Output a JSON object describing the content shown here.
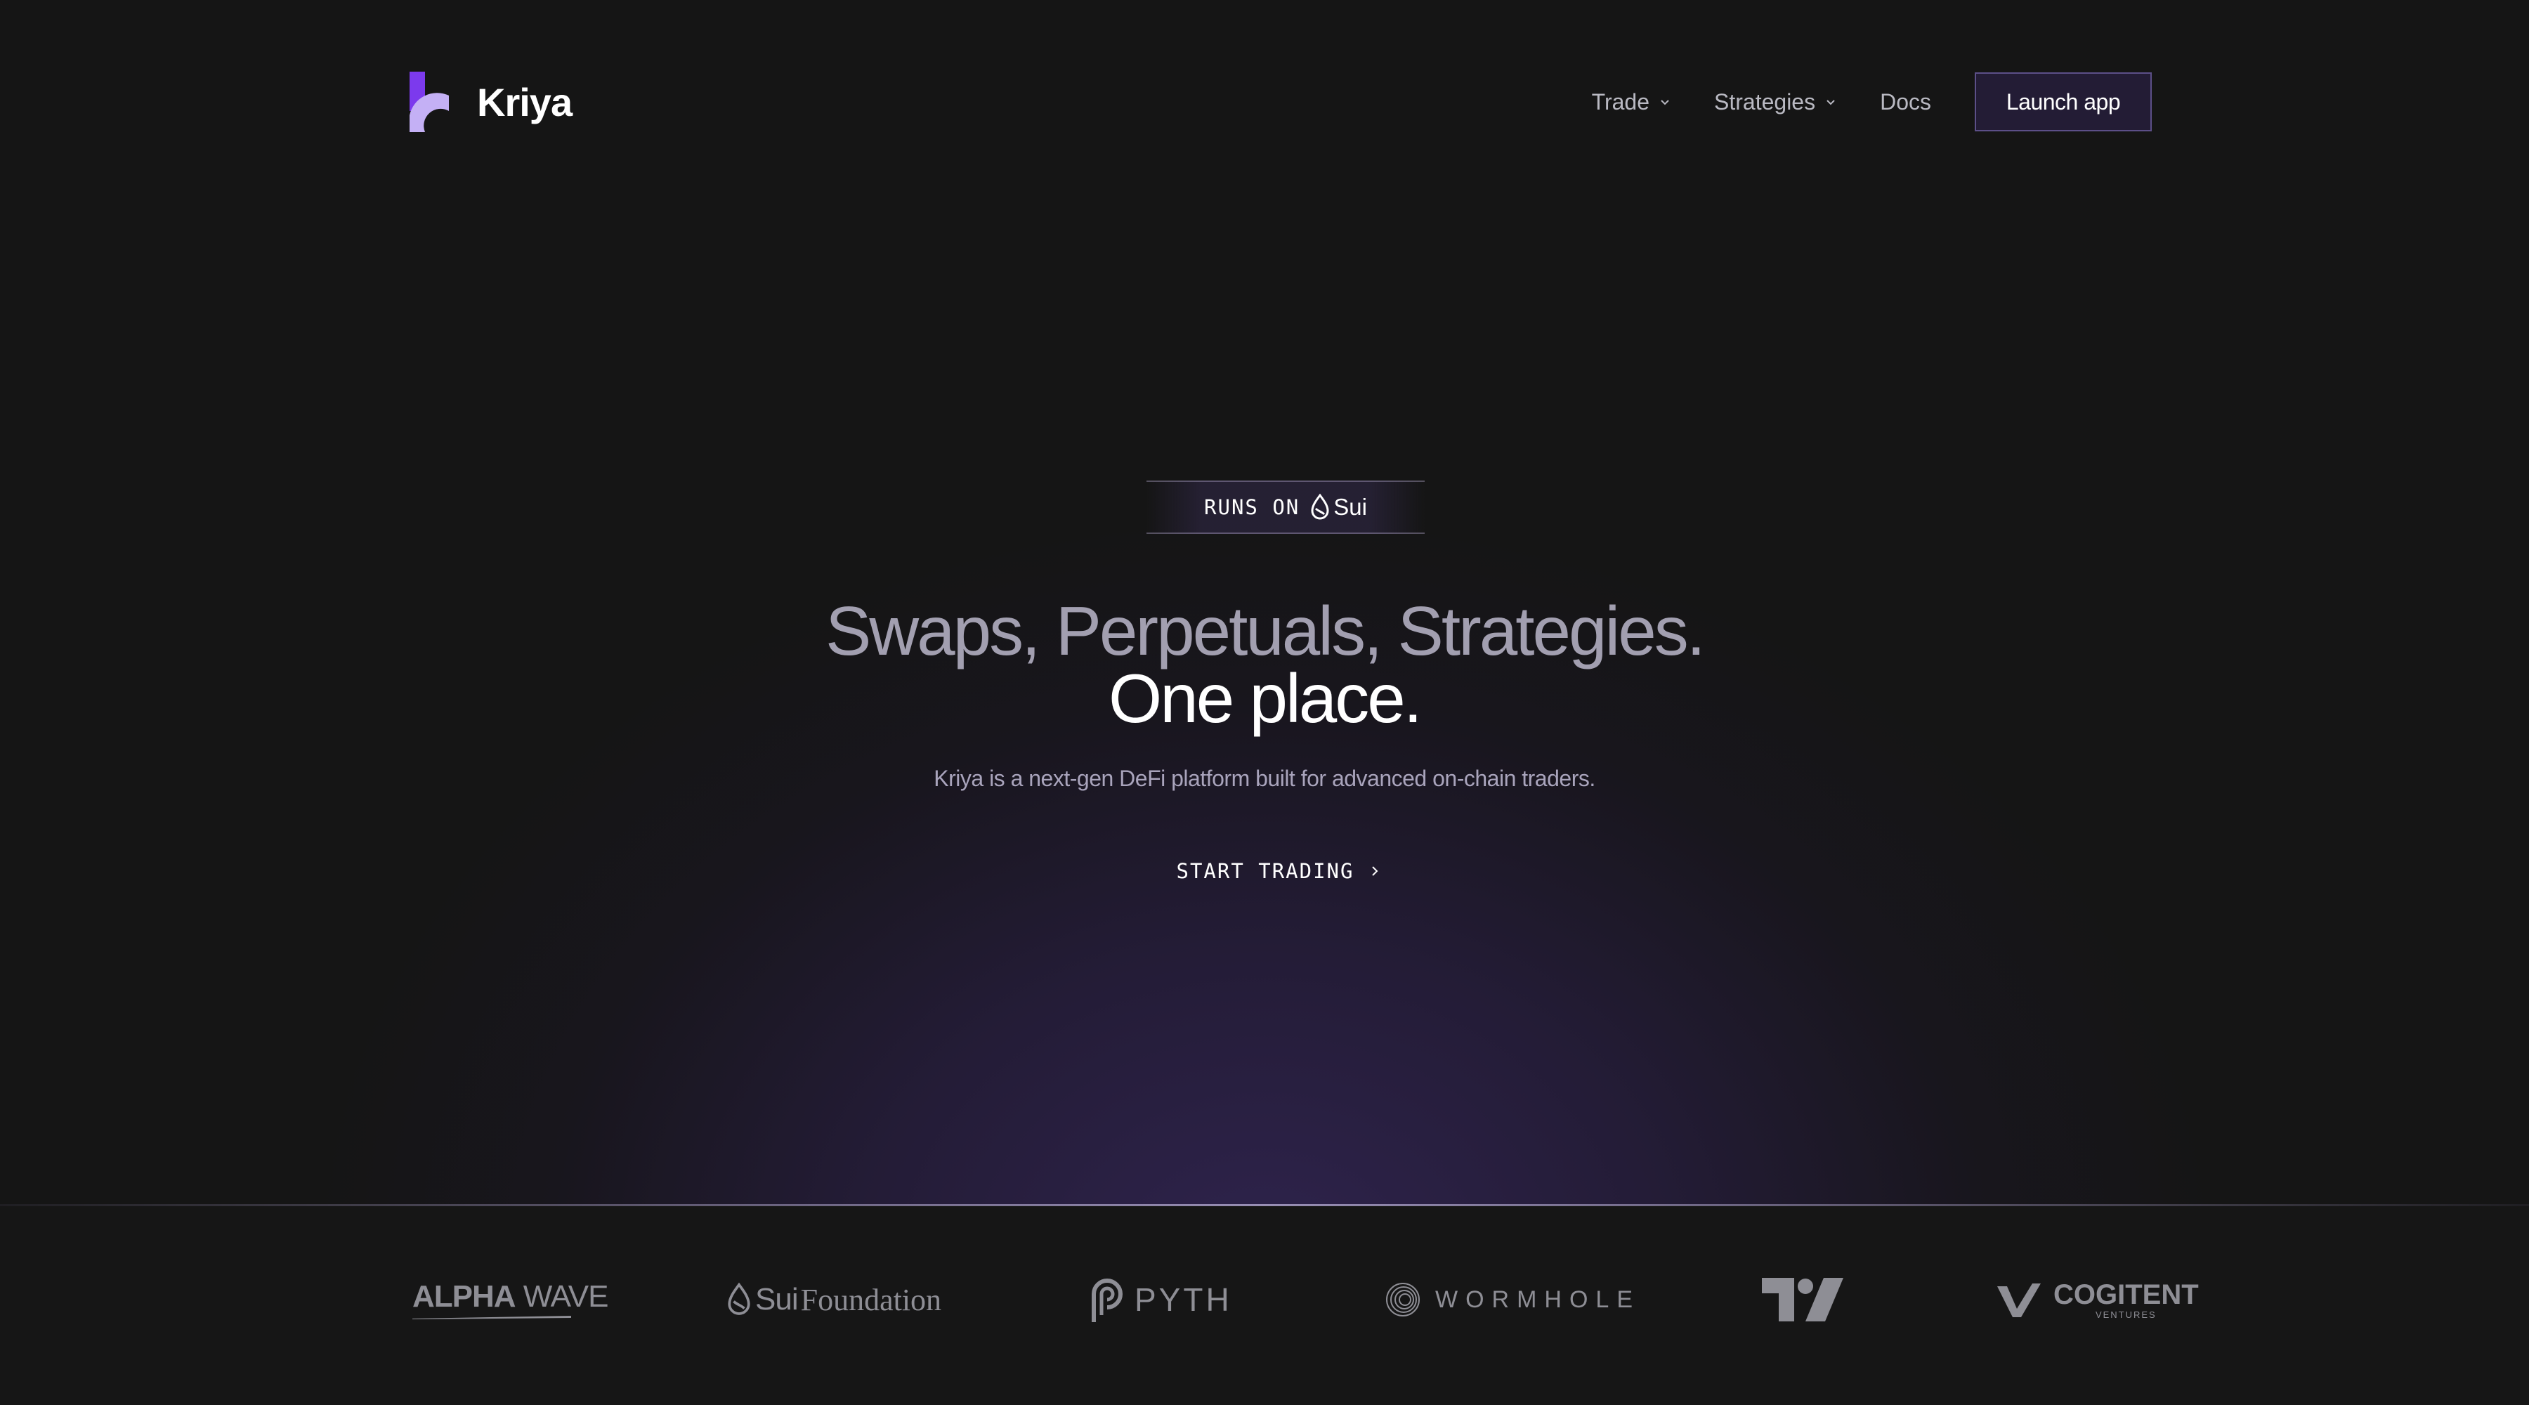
{
  "header": {
    "brand": "Kriya",
    "nav": [
      {
        "label": "Trade",
        "has_dropdown": true
      },
      {
        "label": "Strategies",
        "has_dropdown": true
      },
      {
        "label": "Docs",
        "has_dropdown": false
      }
    ],
    "launch_label": "Launch app"
  },
  "hero": {
    "badge_prefix": "RUNS ON",
    "badge_network": "Sui",
    "headline_line1": "Swaps, Perpetuals, Strategies.",
    "headline_line2": "One place.",
    "subtitle": "Kriya is a next-gen DeFi platform built for advanced on-chain traders.",
    "cta_label": "START TRADING"
  },
  "partners": {
    "alpha_wave": {
      "bold": "ALPHA",
      "light": " WAVE"
    },
    "sui_foundation": {
      "sui": "Sui",
      "foundation": "Foundation"
    },
    "pyth": "PYTH",
    "wormhole": "WORMHOLE",
    "tradingview": "TV",
    "cogitent": {
      "main": "COGITENT",
      "sub": "VENTURES"
    }
  },
  "colors": {
    "background": "#151515",
    "accent_purple": "#8b5cf6",
    "logo_light": "#c4b0f5",
    "button_border": "#5c4f88",
    "button_fill": "#231c35",
    "headline_muted": "#a29fb0",
    "partner_gray": "#8e8e95"
  },
  "icons": {
    "chevron": "chevron-down-icon",
    "cta_arrow": "chevron-right-icon",
    "sui_drop": "sui-drop-icon"
  }
}
